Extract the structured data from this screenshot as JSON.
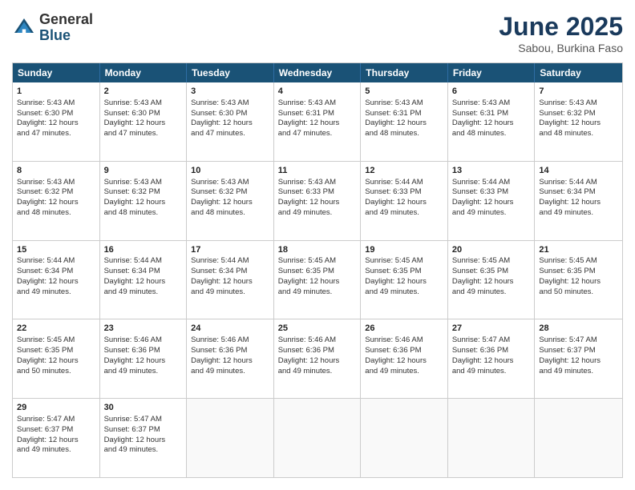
{
  "logo": {
    "general": "General",
    "blue": "Blue"
  },
  "title": "June 2025",
  "subtitle": "Sabou, Burkina Faso",
  "weekdays": [
    "Sunday",
    "Monday",
    "Tuesday",
    "Wednesday",
    "Thursday",
    "Friday",
    "Saturday"
  ],
  "weeks": [
    [
      {
        "day": "1",
        "lines": [
          "Sunrise: 5:43 AM",
          "Sunset: 6:30 PM",
          "Daylight: 12 hours",
          "and 47 minutes."
        ]
      },
      {
        "day": "2",
        "lines": [
          "Sunrise: 5:43 AM",
          "Sunset: 6:30 PM",
          "Daylight: 12 hours",
          "and 47 minutes."
        ]
      },
      {
        "day": "3",
        "lines": [
          "Sunrise: 5:43 AM",
          "Sunset: 6:30 PM",
          "Daylight: 12 hours",
          "and 47 minutes."
        ]
      },
      {
        "day": "4",
        "lines": [
          "Sunrise: 5:43 AM",
          "Sunset: 6:31 PM",
          "Daylight: 12 hours",
          "and 47 minutes."
        ]
      },
      {
        "day": "5",
        "lines": [
          "Sunrise: 5:43 AM",
          "Sunset: 6:31 PM",
          "Daylight: 12 hours",
          "and 48 minutes."
        ]
      },
      {
        "day": "6",
        "lines": [
          "Sunrise: 5:43 AM",
          "Sunset: 6:31 PM",
          "Daylight: 12 hours",
          "and 48 minutes."
        ]
      },
      {
        "day": "7",
        "lines": [
          "Sunrise: 5:43 AM",
          "Sunset: 6:32 PM",
          "Daylight: 12 hours",
          "and 48 minutes."
        ]
      }
    ],
    [
      {
        "day": "8",
        "lines": [
          "Sunrise: 5:43 AM",
          "Sunset: 6:32 PM",
          "Daylight: 12 hours",
          "and 48 minutes."
        ]
      },
      {
        "day": "9",
        "lines": [
          "Sunrise: 5:43 AM",
          "Sunset: 6:32 PM",
          "Daylight: 12 hours",
          "and 48 minutes."
        ]
      },
      {
        "day": "10",
        "lines": [
          "Sunrise: 5:43 AM",
          "Sunset: 6:32 PM",
          "Daylight: 12 hours",
          "and 48 minutes."
        ]
      },
      {
        "day": "11",
        "lines": [
          "Sunrise: 5:43 AM",
          "Sunset: 6:33 PM",
          "Daylight: 12 hours",
          "and 49 minutes."
        ]
      },
      {
        "day": "12",
        "lines": [
          "Sunrise: 5:44 AM",
          "Sunset: 6:33 PM",
          "Daylight: 12 hours",
          "and 49 minutes."
        ]
      },
      {
        "day": "13",
        "lines": [
          "Sunrise: 5:44 AM",
          "Sunset: 6:33 PM",
          "Daylight: 12 hours",
          "and 49 minutes."
        ]
      },
      {
        "day": "14",
        "lines": [
          "Sunrise: 5:44 AM",
          "Sunset: 6:34 PM",
          "Daylight: 12 hours",
          "and 49 minutes."
        ]
      }
    ],
    [
      {
        "day": "15",
        "lines": [
          "Sunrise: 5:44 AM",
          "Sunset: 6:34 PM",
          "Daylight: 12 hours",
          "and 49 minutes."
        ]
      },
      {
        "day": "16",
        "lines": [
          "Sunrise: 5:44 AM",
          "Sunset: 6:34 PM",
          "Daylight: 12 hours",
          "and 49 minutes."
        ]
      },
      {
        "day": "17",
        "lines": [
          "Sunrise: 5:44 AM",
          "Sunset: 6:34 PM",
          "Daylight: 12 hours",
          "and 49 minutes."
        ]
      },
      {
        "day": "18",
        "lines": [
          "Sunrise: 5:45 AM",
          "Sunset: 6:35 PM",
          "Daylight: 12 hours",
          "and 49 minutes."
        ]
      },
      {
        "day": "19",
        "lines": [
          "Sunrise: 5:45 AM",
          "Sunset: 6:35 PM",
          "Daylight: 12 hours",
          "and 49 minutes."
        ]
      },
      {
        "day": "20",
        "lines": [
          "Sunrise: 5:45 AM",
          "Sunset: 6:35 PM",
          "Daylight: 12 hours",
          "and 49 minutes."
        ]
      },
      {
        "day": "21",
        "lines": [
          "Sunrise: 5:45 AM",
          "Sunset: 6:35 PM",
          "Daylight: 12 hours",
          "and 50 minutes."
        ]
      }
    ],
    [
      {
        "day": "22",
        "lines": [
          "Sunrise: 5:45 AM",
          "Sunset: 6:35 PM",
          "Daylight: 12 hours",
          "and 50 minutes."
        ]
      },
      {
        "day": "23",
        "lines": [
          "Sunrise: 5:46 AM",
          "Sunset: 6:36 PM",
          "Daylight: 12 hours",
          "and 49 minutes."
        ]
      },
      {
        "day": "24",
        "lines": [
          "Sunrise: 5:46 AM",
          "Sunset: 6:36 PM",
          "Daylight: 12 hours",
          "and 49 minutes."
        ]
      },
      {
        "day": "25",
        "lines": [
          "Sunrise: 5:46 AM",
          "Sunset: 6:36 PM",
          "Daylight: 12 hours",
          "and 49 minutes."
        ]
      },
      {
        "day": "26",
        "lines": [
          "Sunrise: 5:46 AM",
          "Sunset: 6:36 PM",
          "Daylight: 12 hours",
          "and 49 minutes."
        ]
      },
      {
        "day": "27",
        "lines": [
          "Sunrise: 5:47 AM",
          "Sunset: 6:36 PM",
          "Daylight: 12 hours",
          "and 49 minutes."
        ]
      },
      {
        "day": "28",
        "lines": [
          "Sunrise: 5:47 AM",
          "Sunset: 6:37 PM",
          "Daylight: 12 hours",
          "and 49 minutes."
        ]
      }
    ],
    [
      {
        "day": "29",
        "lines": [
          "Sunrise: 5:47 AM",
          "Sunset: 6:37 PM",
          "Daylight: 12 hours",
          "and 49 minutes."
        ]
      },
      {
        "day": "30",
        "lines": [
          "Sunrise: 5:47 AM",
          "Sunset: 6:37 PM",
          "Daylight: 12 hours",
          "and 49 minutes."
        ]
      },
      null,
      null,
      null,
      null,
      null
    ]
  ]
}
